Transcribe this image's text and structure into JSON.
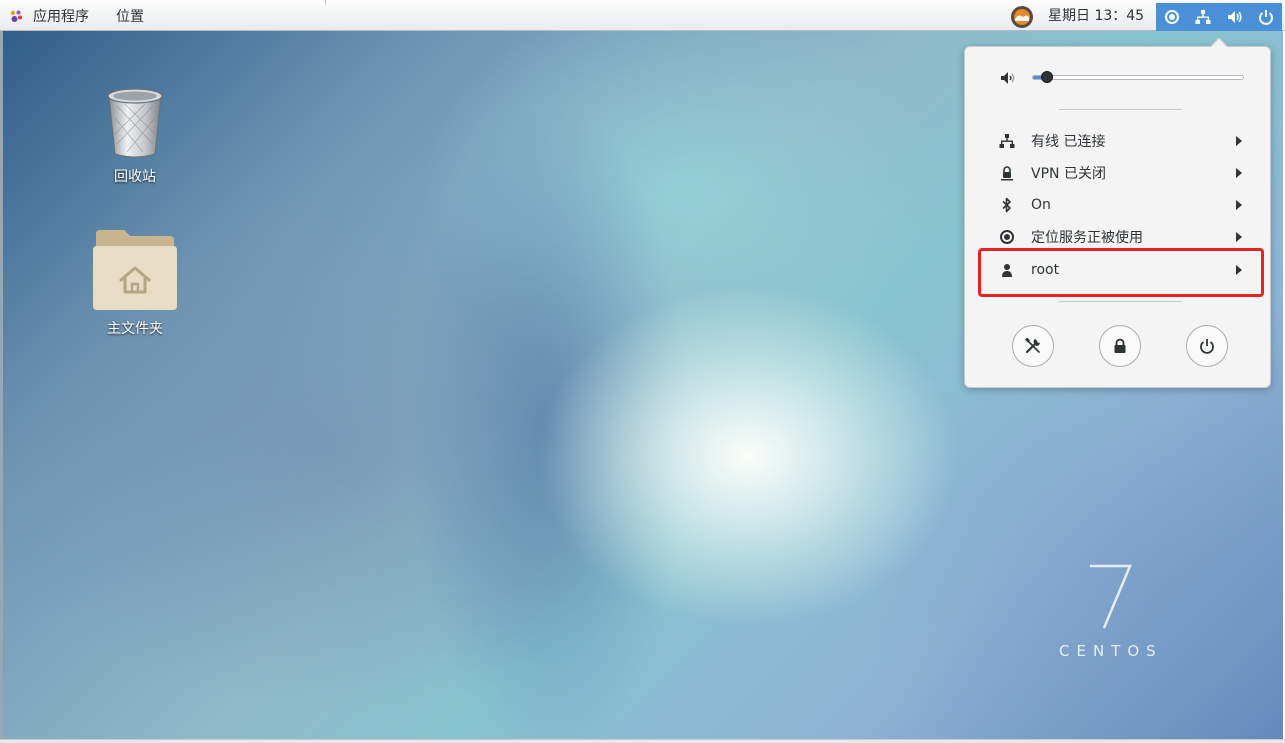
{
  "topbar": {
    "applications_label": "应用程序",
    "places_label": "位置",
    "clock": "星期日 13：45",
    "weather_icon": "weather-icon",
    "status_icons": [
      "location-icon",
      "network-wired-icon",
      "volume-icon",
      "power-icon"
    ],
    "accent_color": "#4a90d9"
  },
  "desktop": {
    "icons": [
      {
        "label": "回收站",
        "icon": "trash-icon"
      },
      {
        "label": "主文件夹",
        "icon": "home-folder-icon"
      }
    ],
    "watermark": {
      "number": "7",
      "word": "CENTOS"
    }
  },
  "system_menu": {
    "volume_level": 0.07,
    "items": [
      {
        "icon": "network-wired-icon",
        "label": "有线 已连接"
      },
      {
        "icon": "vpn-lock-icon",
        "label": "VPN 已关闭"
      },
      {
        "icon": "bluetooth-icon",
        "label": "On"
      },
      {
        "icon": "location-icon",
        "label": "定位服务正被使用"
      },
      {
        "icon": "user-icon",
        "label": "root"
      }
    ],
    "buttons": [
      {
        "icon": "settings-icon"
      },
      {
        "icon": "lock-icon"
      },
      {
        "icon": "power-icon"
      }
    ],
    "highlight_color": "#e82222"
  }
}
